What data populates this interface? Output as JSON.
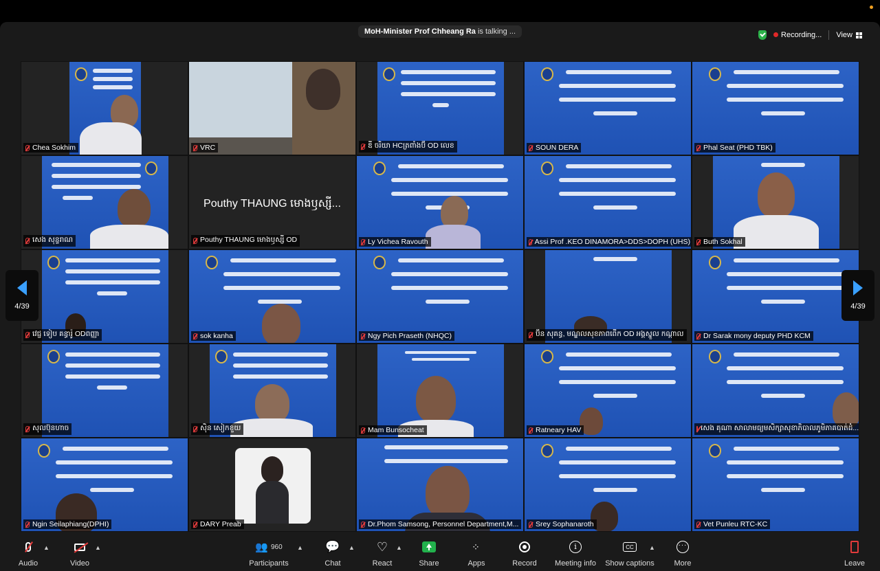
{
  "top_notice": {
    "speaker": "MoH-Minister Prof Chheang Ra",
    "suffix": "is talking ..."
  },
  "recording": {
    "label": "Recording..."
  },
  "view": {
    "label": "View"
  },
  "pager": {
    "left": "4/39",
    "right": "4/39"
  },
  "tiles": [
    {
      "name": "Chea Sokhim",
      "muted": true
    },
    {
      "name": "VRC",
      "muted": true
    },
    {
      "name": "ឌី ចរិយា HCត្រពាំងប៊ី OD លេខ",
      "muted": true
    },
    {
      "name": "SOUN DERA",
      "muted": true
    },
    {
      "name": "Phal Seat (PHD TBK)",
      "muted": true
    },
    {
      "name": "សេង សុន្ទរាណ",
      "muted": true
    },
    {
      "name": "Pouthy THAUNG មោងឫស្សី OD",
      "muted": true,
      "big_name": "Pouthy THAUNG មោងឫស្សី..."
    },
    {
      "name": "Ly Vichea Ravouth",
      "muted": true
    },
    {
      "name": "Assi Prof .KEO DINAMORA>DDS>DOPH (UHS)",
      "muted": true
    },
    {
      "name": "Buth Sokhal",
      "muted": true
    },
    {
      "name": "វេជ្ជ ទៀប គន្ធារ៉ូ ODពញ្ញា",
      "muted": true
    },
    {
      "name": "sok kanha",
      "muted": true
    },
    {
      "name": "Ngy Pich Praseth (NHQC)",
      "muted": true
    },
    {
      "name": "ប៊ិន សុគន្ធ, មណ្ឌលសុខភាពពើក OD អង្គស្នួល កណ្ដាល",
      "muted": true
    },
    {
      "name": "Dr Sarak mony deputy PHD KCM",
      "muted": true
    },
    {
      "name": "សុលប៊ុនហាច",
      "muted": true
    },
    {
      "name": "ស៊ិន សៀកខួយ",
      "muted": true
    },
    {
      "name": "Mam Bunsocheat",
      "muted": true
    },
    {
      "name": "Ratneary HAV",
      "muted": true
    },
    {
      "name": "សេង គុណា សាលាមធ្យមសិក្សាសុខាភិបាលភូមិភាគបាត់ដំ...",
      "muted": true
    },
    {
      "name": "Ngin Seilaphiang(DPHI)",
      "muted": true
    },
    {
      "name": "DARY Preab",
      "muted": true
    },
    {
      "name": "Dr.Phom Samsong, Personnel Department,M...",
      "muted": true
    },
    {
      "name": "Srey Sophanaroth",
      "muted": true
    },
    {
      "name": "Vet Punleu RTC-KC",
      "muted": true
    }
  ],
  "toolbar": {
    "audio": "Audio",
    "video": "Video",
    "participants": "Participants",
    "participants_count": "960",
    "chat": "Chat",
    "react": "React",
    "share": "Share",
    "apps": "Apps",
    "record": "Record",
    "meeting_info": "Meeting info",
    "captions": "Show captions",
    "captions_icon": "CC",
    "more": "More",
    "leave": "Leave"
  }
}
